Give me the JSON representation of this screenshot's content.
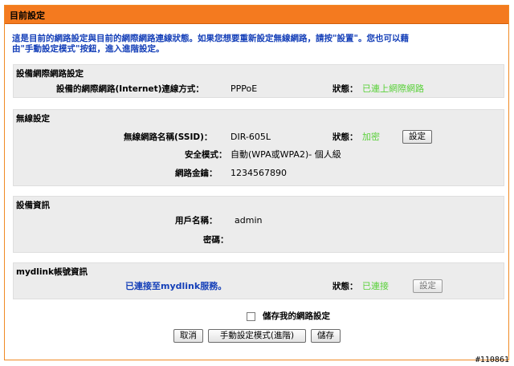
{
  "header": {
    "title": "目前設定"
  },
  "intro": {
    "line1": "這是目前的網路設定與目前的網際網路連線狀態。如果您想要重新設定無線網路，請按\"設置\"。您也可以藉",
    "line2": "由\"手動設定模式\"按鈕，進入進階設定。"
  },
  "internet": {
    "heading": "設備網際網路設定",
    "conn_label": "設備的網際網路(Internet)連線方式：",
    "conn_value": "PPPoE",
    "status_label": "狀態：",
    "status_value": "已連上網際網路"
  },
  "wireless": {
    "heading": "無線設定",
    "ssid_label": "無線網路名稱(SSID)：",
    "ssid_value": "DIR-605L",
    "status_label": "狀態：",
    "status_value": "加密",
    "setup_button": "設定",
    "security_label": "安全模式：",
    "security_value": "自動(WPA或WPA2)- 個人級",
    "key_label": "網路金鑰：",
    "key_value": "1234567890"
  },
  "device": {
    "heading": "設備資訊",
    "user_label": "用戶名稱：",
    "user_value": "admin",
    "password_label": "密碼："
  },
  "mydlink": {
    "heading": "mydlink帳號資訊",
    "connected_text": "已連接至mydlink服務。",
    "status_label": "狀態：",
    "status_value": "已連接",
    "setup_button": "設定"
  },
  "footer": {
    "save_checkbox_label": "儲存我的網路設定",
    "cancel_button": "取消",
    "manual_button": "手動設定模式(進階)",
    "save_button": "儲存"
  },
  "watermark": "#110861",
  "colors": {
    "title_bar": "#f47a1f",
    "intro_text": "#143fb8",
    "status_green": "#5ad13a",
    "section_bg": "#ececec"
  }
}
